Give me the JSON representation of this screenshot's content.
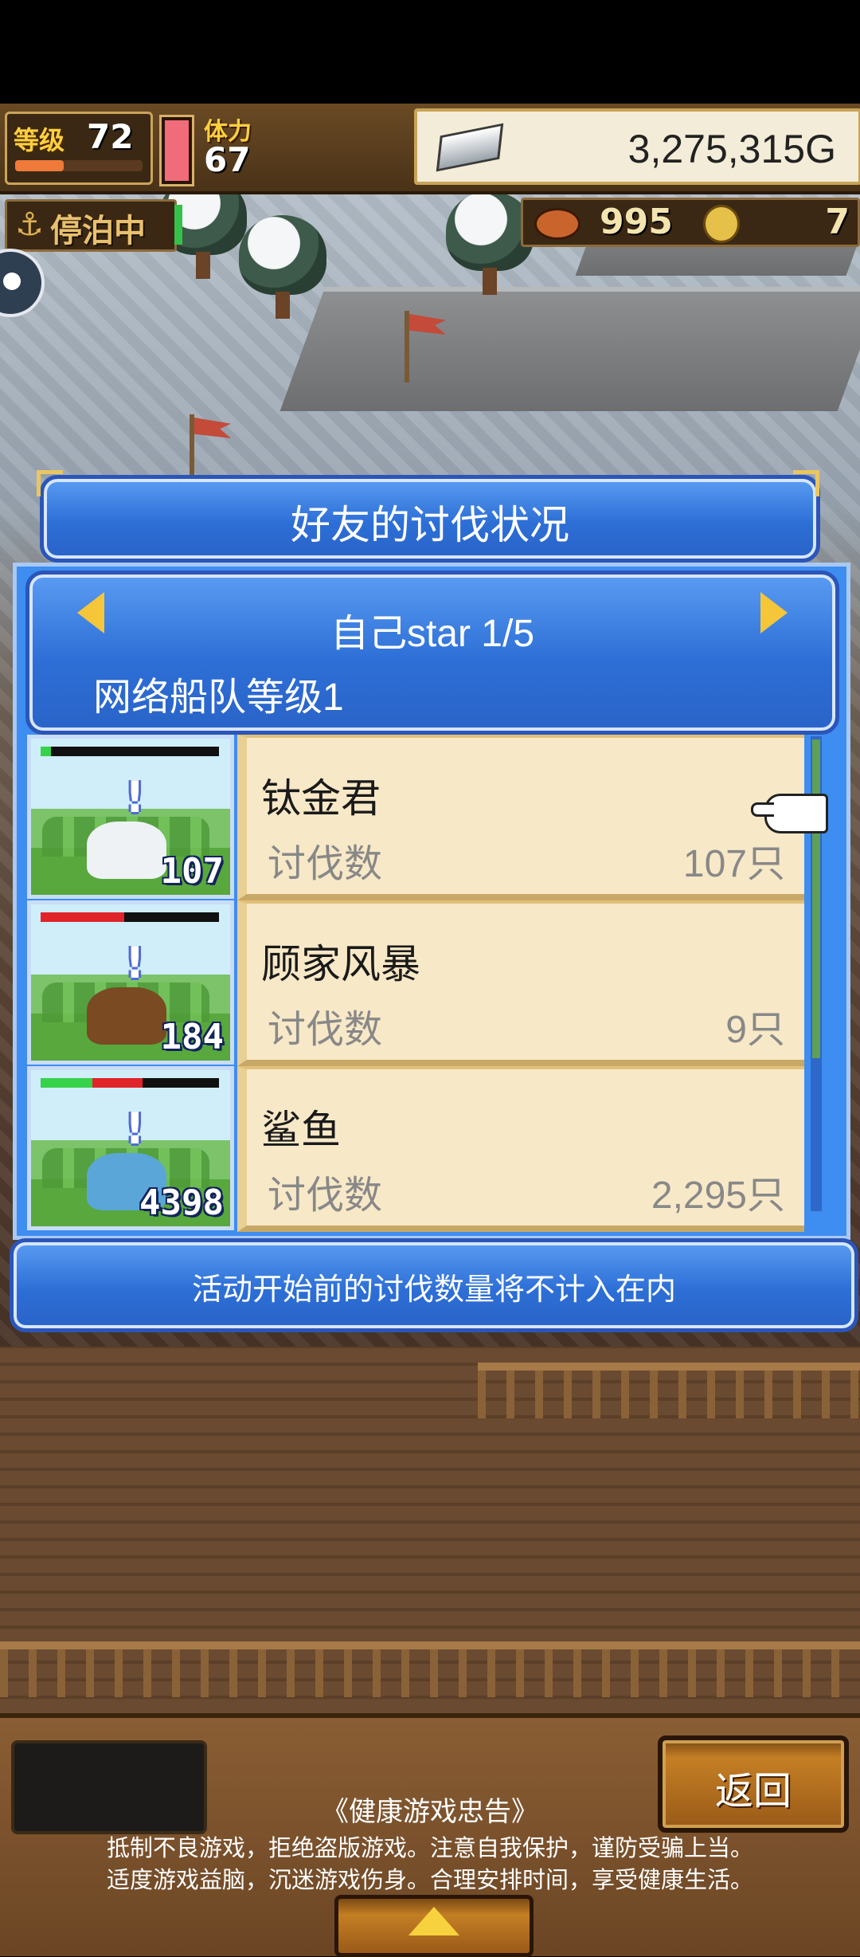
{
  "hud": {
    "level_label": "等级",
    "level": "72",
    "stamina_label": "体力",
    "stamina": "67",
    "gold": "3,275,315G",
    "status": "停泊中",
    "resource1": "995",
    "resource2": "7",
    "xp_fraction": 0.38
  },
  "dialog": {
    "title": "好友的讨伐状况",
    "page": "自己star 1/5",
    "network_level": "网络船队等级1",
    "rows": [
      {
        "name": "钛金君",
        "kill_label": "讨伐数",
        "kill_value": "107只",
        "count": "107",
        "hp_green": 0.06,
        "hp_red": 0.0
      },
      {
        "name": "顾家风暴",
        "kill_label": "讨伐数",
        "kill_value": "9只",
        "count": "184",
        "hp_green": 0.0,
        "hp_red": 0.47
      },
      {
        "name": "鲨鱼",
        "kill_label": "讨伐数",
        "kill_value": "2,295只",
        "count": "4398",
        "hp_green": 0.29,
        "hp_red": 0.28
      }
    ],
    "note": "活动开始前的讨伐数量将不计入在内"
  },
  "bottom": {
    "back_label": "返回",
    "health_title": "《健康游戏忠告》",
    "health_line1": "抵制不良游戏，拒绝盗版游戏。注意自我保护，谨防受骗上当。",
    "health_line2": "适度游戏益脑，沉迷游戏伤身。合理安排时间，享受健康生活。"
  },
  "colors": {
    "panel_blue": "#2d6fd6",
    "card_bg": "#f7e8c7",
    "gold_accent": "#e9c662",
    "hp_green": "#36d24a",
    "hp_red": "#e0242a"
  },
  "icons": [
    "anchor-icon",
    "silver-ingot-icon",
    "meat-icon",
    "coin-icon",
    "left-arrow-icon",
    "right-arrow-icon",
    "pointer-hand-icon",
    "up-arrow-icon"
  ]
}
